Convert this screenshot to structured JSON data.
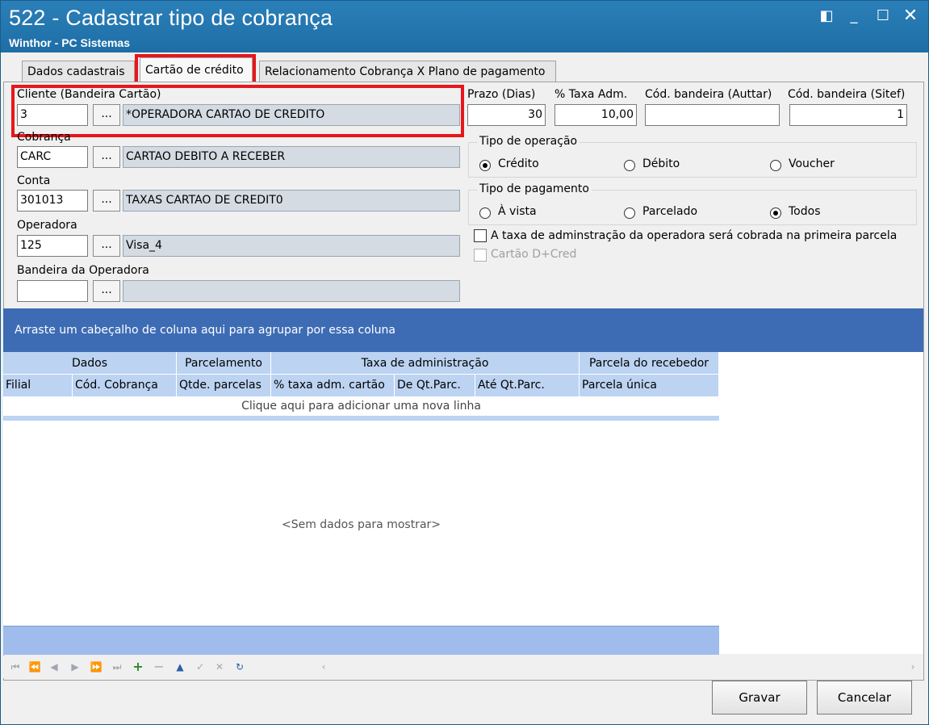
{
  "window": {
    "title": "522 - Cadastrar tipo de cobrança",
    "subtitle": "Winthor - PC Sistemas"
  },
  "tabs": [
    {
      "label": "Dados cadastrais"
    },
    {
      "label": "Cartão de crédito"
    },
    {
      "label": "Relacionamento Cobrança X Plano de pagamento"
    }
  ],
  "form": {
    "cliente_label": "Cliente (Bandeira Cartão)",
    "cliente_code": "3",
    "cliente_desc": "*OPERADORA CARTAO DE CREDITO",
    "cobranca_label": "Cobrança",
    "cobranca_code": "CARC",
    "cobranca_desc": "CARTAO DEBITO A RECEBER",
    "conta_label": "Conta",
    "conta_code": "301013",
    "conta_desc": "TAXAS CARTAO DE CREDIT0",
    "operadora_label": "Operadora",
    "operadora_code": "125",
    "operadora_desc": "Visa_4",
    "bandeira_label": "Bandeira da Operadora",
    "bandeira_code": "",
    "bandeira_desc": "",
    "dots": "...",
    "prazo_label": "Prazo (Dias)",
    "prazo_value": "30",
    "taxa_label": "% Taxa Adm.",
    "taxa_value": "10,00",
    "auttar_label": "Cód. bandeira (Auttar)",
    "auttar_value": "",
    "sitef_label": "Cód. bandeira (Sitef)",
    "sitef_value": "1",
    "tipo_operacao_label": "Tipo de operação",
    "op_credito": "Crédito",
    "op_debito": "Débito",
    "op_voucher": "Voucher",
    "tipo_pagamento_label": "Tipo de pagamento",
    "pg_avista": "À vista",
    "pg_parcelado": "Parcelado",
    "pg_todos": "Todos",
    "chk_taxa_label": "A taxa de adminstração da operadora será cobrada na primeira parcela",
    "chk_dcred_label": "Cartão D+Cred"
  },
  "grid": {
    "group_hint": "Arraste um cabeçalho de coluna aqui para agrupar por essa coluna",
    "bands": [
      "Dados",
      "Parcelamento",
      "Taxa de administração",
      "Parcela do recebedor"
    ],
    "columns": [
      "Filial",
      "Cód. Cobrança",
      "Qtde. parcelas",
      "% taxa adm. cartão",
      "De Qt.Parc.",
      "Até Qt.Parc.",
      "Parcela única"
    ],
    "new_row": "Clique aqui para adicionar uma nova linha",
    "empty": "<Sem dados para mostrar>"
  },
  "buttons": {
    "save": "Gravar",
    "cancel": "Cancelar"
  },
  "colors": {
    "highlight": "#e8161a",
    "titlebar": "#2277b0",
    "group_panel": "#3d6cb5"
  }
}
